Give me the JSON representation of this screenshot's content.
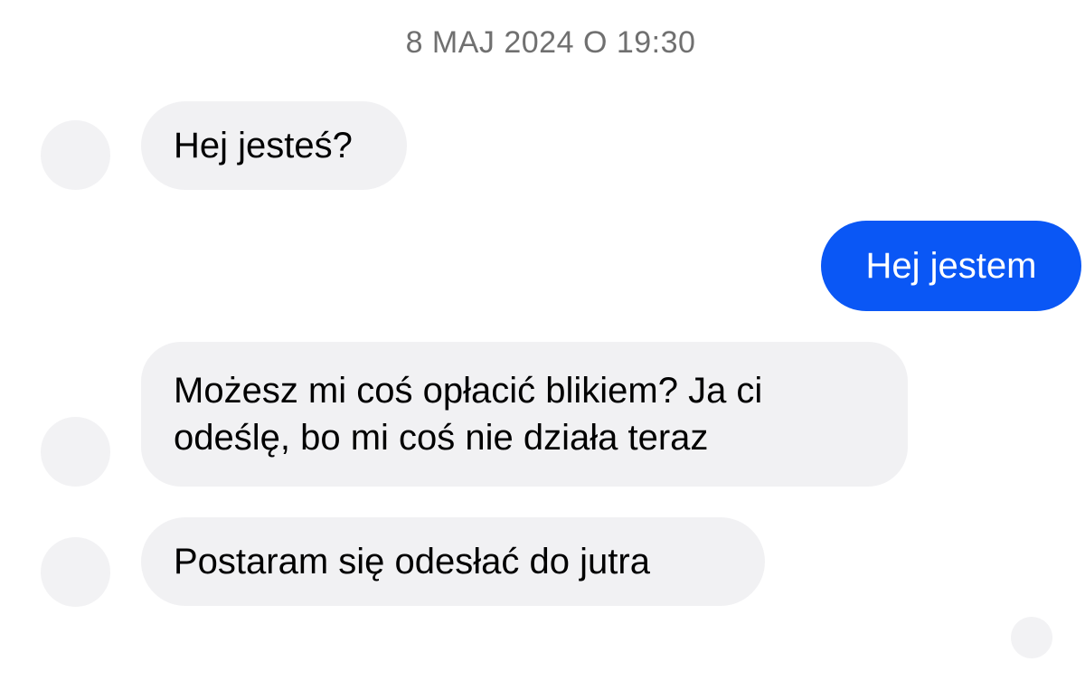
{
  "conversation": {
    "timestamp": "8 MAJ 2024 O 19:30",
    "messages": [
      {
        "direction": "incoming",
        "text": "Hej jesteś?"
      },
      {
        "direction": "outgoing",
        "text": "Hej jestem"
      },
      {
        "direction": "incoming",
        "text": "Możesz mi coś opłacić blikiem? Ja ci odeślę, bo mi coś nie działa teraz"
      },
      {
        "direction": "incoming",
        "text": "Postaram się odesłać do jutra"
      }
    ]
  },
  "colors": {
    "outgoing_bubble": "#0a57f5",
    "incoming_bubble": "#f1f1f3",
    "timestamp_text": "#707070"
  }
}
